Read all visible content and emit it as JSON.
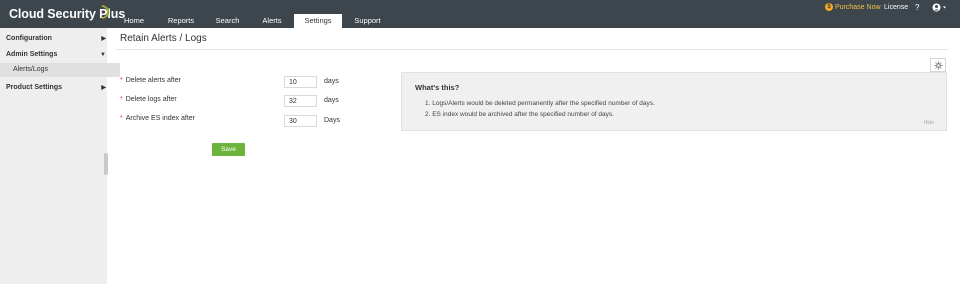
{
  "app": {
    "name": "Cloud Security Plus"
  },
  "nav": {
    "tabs": [
      {
        "label": "Home"
      },
      {
        "label": "Reports"
      },
      {
        "label": "Search"
      },
      {
        "label": "Alerts"
      },
      {
        "label": "Settings"
      },
      {
        "label": "Support"
      }
    ],
    "active_tab": "Settings"
  },
  "header_right": {
    "purchase": "Purchase Now",
    "license": "License",
    "help": "?",
    "user_icon": "user-circle-icon"
  },
  "sidebar": {
    "items": [
      {
        "label": "Configuration",
        "expanded": false
      },
      {
        "label": "Admin Settings",
        "expanded": true
      },
      {
        "label": "Alerts/Logs",
        "selected": true
      },
      {
        "label": "Product Settings",
        "expanded": false
      }
    ]
  },
  "main": {
    "title": "Retain Alerts / Logs",
    "fields": [
      {
        "label": "Delete alerts after",
        "value": "10",
        "unit": "days"
      },
      {
        "label": "Delete logs after",
        "value": "32",
        "unit": "days"
      },
      {
        "label": "Archive ES index after",
        "value": "30",
        "unit": "Days"
      }
    ],
    "save_label": "Save"
  },
  "info": {
    "title": "What's this?",
    "lines": [
      "1. Logs/Alerts would be deleted permanently after the specified number of days.",
      "2. ES index would be archived after the specified number of days."
    ],
    "hide": "Hide"
  },
  "colors": {
    "topbar": "#3d464d",
    "save": "#6cb33e",
    "required": "#e03c31",
    "purchase": "#f5c242"
  }
}
